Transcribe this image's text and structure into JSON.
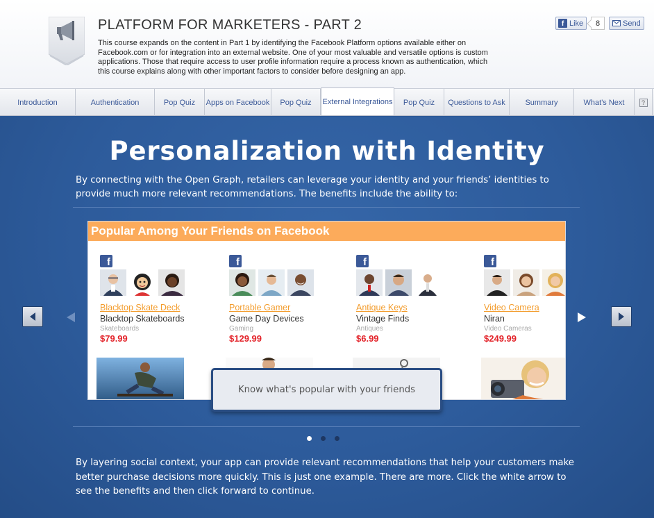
{
  "header": {
    "title": "PLATFORM FOR MARKETERS - PART 2",
    "description": "This course expands on the content in Part 1 by identifying the Facebook Platform options available either on Facebook.com or for integration into an external website. One of your most valuable and versatile options is custom applications. Those that require access to user profile information require a process known as authentication, which this course explains along with other important factors to consider before designing an app.",
    "badge_icon": "megaphone-icon",
    "like_label": "Like",
    "like_count": "8",
    "send_label": "Send"
  },
  "tabs": [
    {
      "label": "Introduction",
      "active": false
    },
    {
      "label": "Authentication",
      "active": false
    },
    {
      "label": "Pop Quiz",
      "active": false
    },
    {
      "label": "Apps on Facebook",
      "active": false
    },
    {
      "label": "Pop Quiz",
      "active": false
    },
    {
      "label": "External Integrations",
      "active": true
    },
    {
      "label": "Pop Quiz",
      "active": false
    },
    {
      "label": "Questions to Ask",
      "active": false
    },
    {
      "label": "Summary",
      "active": false
    },
    {
      "label": "What's Next",
      "active": false
    }
  ],
  "help_label": "?",
  "main": {
    "title": "Personalization with Identity",
    "intro": "By connecting with the Open Graph, retailers can leverage your identity and your friends’ identities to provide much more relevant recommendations. The benefits include the ability to:",
    "outro": "By layering social context, your app can provide relevant recommendations that help your customers make better purchase decisions more quickly. This is just one example. There are more. Click the white arrow to see the benefits and then click forward to continue."
  },
  "panel": {
    "heading": "Popular Among Your Friends on Facebook",
    "fb_letter": "f",
    "products": [
      {
        "name": "Blacktop Skate Deck",
        "store": "Blacktop Skateboards",
        "category": "Skateboards",
        "price": "$79.99"
      },
      {
        "name": "Portable Gamer",
        "store": "Game Day Devices",
        "category": "Gaming",
        "price": "$129.99"
      },
      {
        "name": "Antique Keys",
        "store": "Vintage Finds",
        "category": "Antiques",
        "price": "$6.99"
      },
      {
        "name": "Video Camera",
        "store": "Niran",
        "category": "Video Cameras",
        "price": "$249.99"
      }
    ],
    "caption": "Know what's popular with your friends"
  },
  "colors": {
    "accent_orange": "#fcab5b",
    "price_red": "#e3242b",
    "facebook_blue": "#3b5998",
    "background_blue": "#2b5896"
  },
  "carousel": {
    "slide_count": 3,
    "active_slide": 1
  }
}
